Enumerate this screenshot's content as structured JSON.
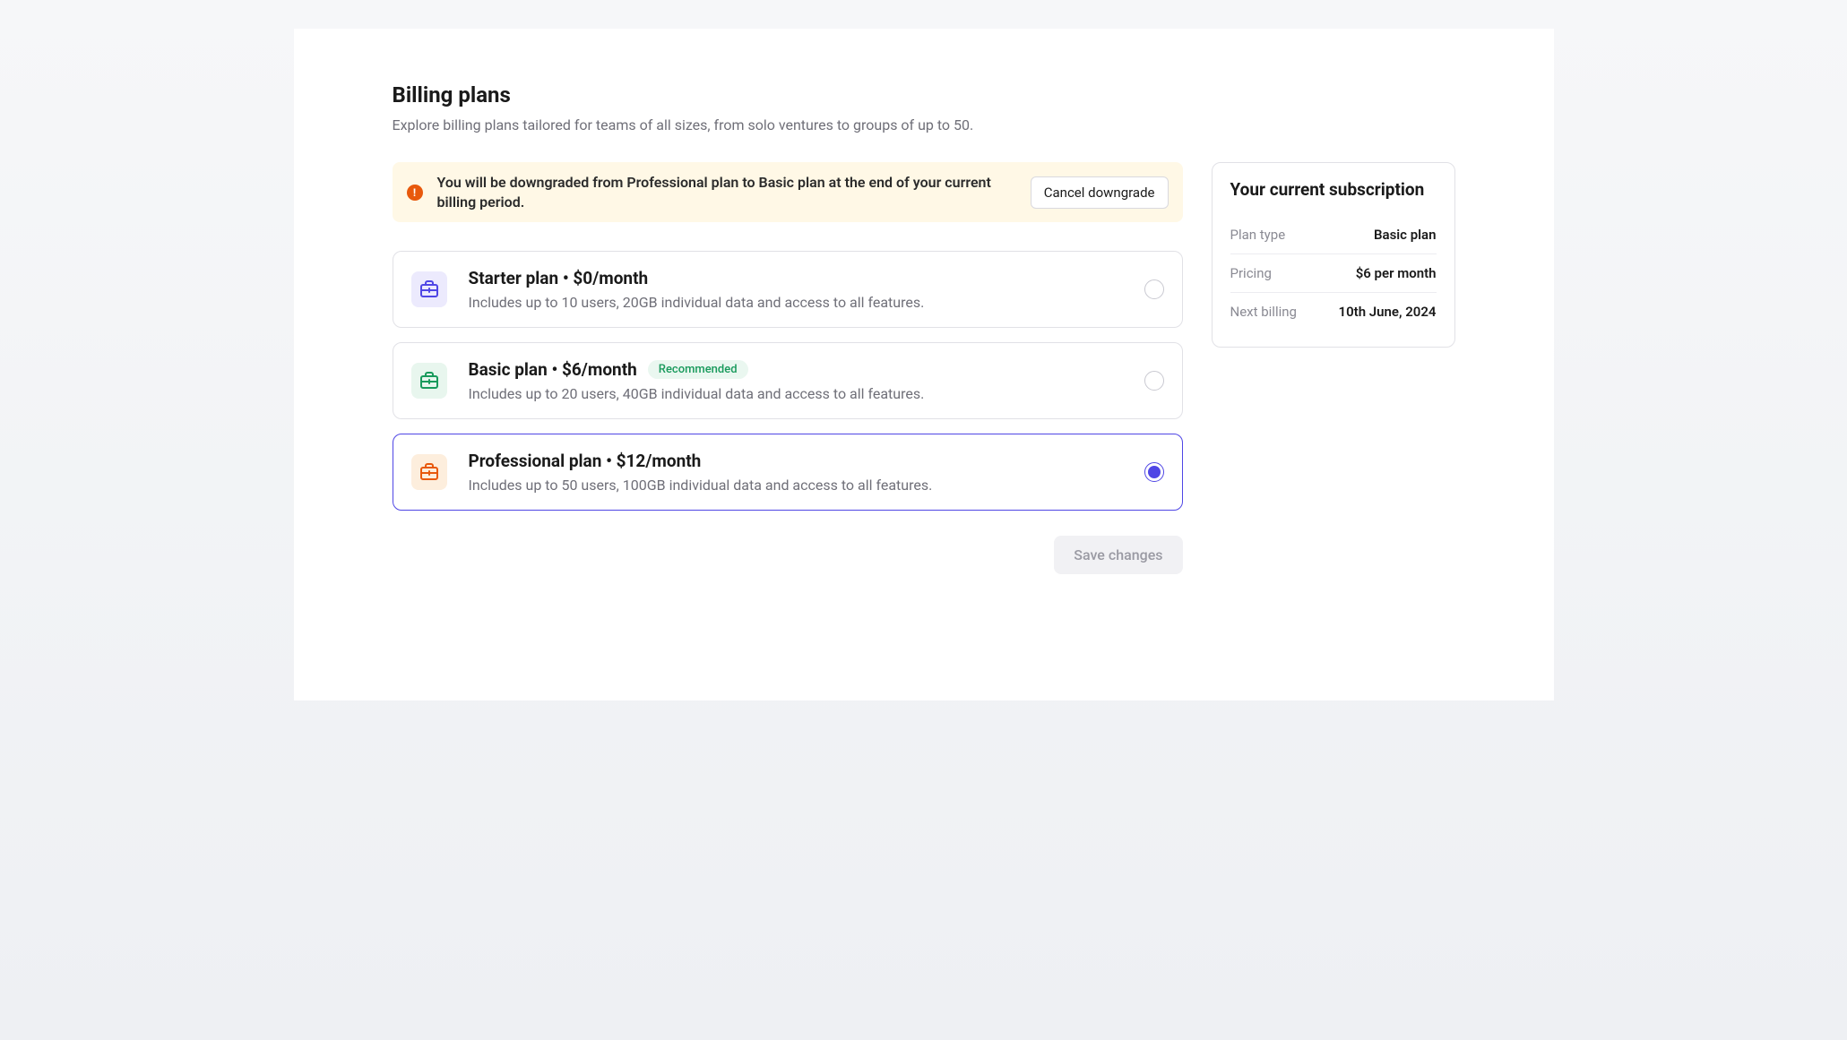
{
  "header": {
    "title": "Billing plans",
    "subtitle": "Explore billing plans tailored for teams of all sizes, from solo ventures to groups of up to 50."
  },
  "banner": {
    "message": "You will be downgraded from Professional plan to Basic plan at the end of your current billing period.",
    "action_label": "Cancel downgrade"
  },
  "plans": [
    {
      "id": "starter",
      "title": "Starter plan • $0/month",
      "description": "Includes up to 10 users, 20GB individual data and access to all features.",
      "icon_bg": "#eceafd",
      "icon_stroke": "#4f46e5",
      "selected": false,
      "recommended": false
    },
    {
      "id": "basic",
      "title": "Basic plan • $6/month",
      "description": "Includes up to 20 users, 40GB individual data and access to all features.",
      "icon_bg": "#e8f6ee",
      "icon_stroke": "#199a5c",
      "selected": false,
      "recommended": true,
      "badge_label": "Recommended"
    },
    {
      "id": "professional",
      "title": "Professional plan • $12/month",
      "description": "Includes up to 50 users, 100GB individual data and access to all features.",
      "icon_bg": "#fdeedd",
      "icon_stroke": "#e8590c",
      "selected": true,
      "recommended": false
    }
  ],
  "actions": {
    "save_label": "Save changes"
  },
  "subscription": {
    "title": "Your current subscription",
    "rows": [
      {
        "label": "Plan type",
        "value": "Basic plan"
      },
      {
        "label": "Pricing",
        "value": "$6 per month"
      },
      {
        "label": "Next billing",
        "value": "10th June, 2024"
      }
    ]
  }
}
